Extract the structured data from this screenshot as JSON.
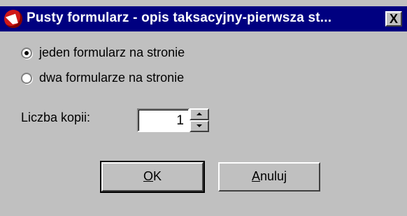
{
  "window": {
    "title": "Pusty formularz - opis taksacyjny-pierwsza st...",
    "close_label": "X"
  },
  "options": [
    {
      "label": "jeden formularz na stronie",
      "checked": true
    },
    {
      "label": "dwa formularze na stronie",
      "checked": false
    }
  ],
  "copies": {
    "label": "Liczba kopii:",
    "value": "1"
  },
  "buttons": {
    "ok_access": "O",
    "ok_rest": "K",
    "cancel_access": "A",
    "cancel_rest": "nuluj"
  },
  "colors": {
    "titlebar": "#000080",
    "face": "#c0c0c0",
    "icon": "#d01818"
  }
}
